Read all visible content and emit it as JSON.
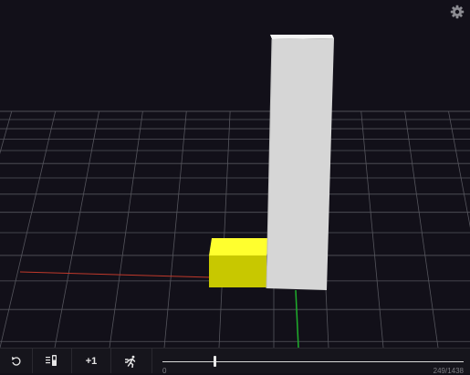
{
  "viewport": {
    "settings_icon": "gear-icon",
    "scene": {
      "floor": "grid",
      "objects": [
        {
          "name": "yellow-box",
          "color": "#ffff00"
        },
        {
          "name": "gray-tower",
          "color": "#d6d6d6"
        }
      ],
      "axes": {
        "x_color": "#c0392b",
        "z_color": "#1fae2c"
      }
    }
  },
  "controls": {
    "buttons": [
      {
        "name": "reset",
        "icon": "rotate-ccw-icon",
        "label": ""
      },
      {
        "name": "step-list",
        "icon": "list-bar-icon",
        "label": ""
      },
      {
        "name": "step-forward",
        "icon": "",
        "label": "+1"
      },
      {
        "name": "run",
        "icon": "running-man-icon",
        "label": ""
      }
    ],
    "timeline": {
      "start_label": "0",
      "frame_count_label": "249/1438",
      "position": 0.17
    }
  }
}
